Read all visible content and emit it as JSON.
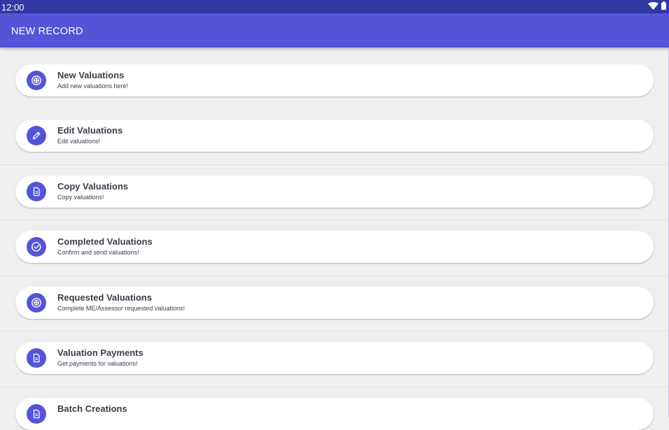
{
  "status_bar": {
    "time": "12:00",
    "icons": [
      "wifi-icon",
      "battery-icon"
    ]
  },
  "app_bar": {
    "title": "NEW RECORD"
  },
  "colors": {
    "status_bar": "#2f39a3",
    "app_bar": "#5454d8",
    "accent": "#5454d8",
    "background": "#efefef",
    "card": "#ffffff",
    "text": "#3a3f4a"
  },
  "menu": {
    "items": [
      {
        "title": "New Valuations",
        "subtitle": "Add new valuations here!",
        "icon": "add-circle-icon"
      },
      {
        "title": "Edit Valuations",
        "subtitle": "Edit valuations!",
        "icon": "pencil-icon"
      },
      {
        "title": "Copy Valuations",
        "subtitle": "Copy valuations!",
        "icon": "document-icon"
      },
      {
        "title": "Completed Valuations",
        "subtitle": "Confirm and send valuations!",
        "icon": "check-circle-icon"
      },
      {
        "title": "Requested Valuations",
        "subtitle": "Complete ME/Assessor requested valuations!",
        "icon": "add-circle-icon"
      },
      {
        "title": "Valuation Payments",
        "subtitle": "Get payments for valuations!",
        "icon": "document-icon"
      },
      {
        "title": "Batch Creations",
        "subtitle": "",
        "icon": "document-icon"
      }
    ]
  }
}
